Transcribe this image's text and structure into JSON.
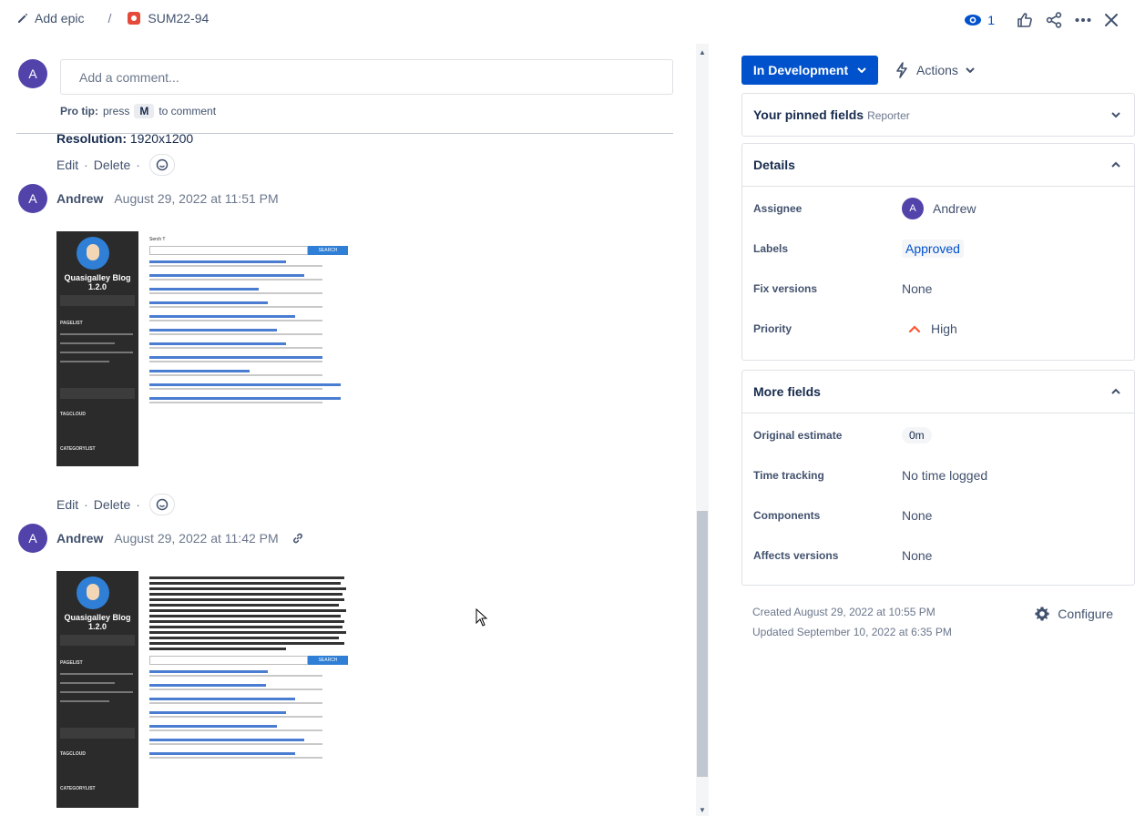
{
  "topbar": {
    "add_epic": "Add epic",
    "issue_key": "SUM22-94",
    "watch_count": "1"
  },
  "comment_box": {
    "avatar": "A",
    "placeholder": "Add a comment...",
    "protip_label": "Pro tip:",
    "protip_press": "press",
    "protip_key": "M",
    "protip_suffix": "to comment"
  },
  "comments": [
    {
      "resolution_label": "Resolution:",
      "resolution_value": "1920x1200",
      "edit": "Edit",
      "delete": "Delete"
    },
    {
      "avatar": "A",
      "author": "Andrew",
      "date": "August 29, 2022 at 11:51 PM",
      "edit": "Edit",
      "delete": "Delete",
      "screenshot": {
        "blog_title": "Quasigalley Blog 1.2.0",
        "search_label": "Serch 'l'",
        "search_button": "SEARCH",
        "side_labels": [
          "PAGELIST",
          "TAGCLOUD",
          "CATEGORYLIST"
        ]
      }
    },
    {
      "avatar": "A",
      "author": "Andrew",
      "date": "August 29, 2022 at 11:42 PM",
      "screenshot": {
        "blog_title": "Quasigalley Blog 1.2.0",
        "search_button": "SEARCH",
        "side_labels": [
          "PAGELIST",
          "TAGCLOUD",
          "CATEGORYLIST"
        ]
      }
    }
  ],
  "sidebar": {
    "status": "In Development",
    "actions": "Actions",
    "pinned": {
      "title": "Your pinned fields",
      "sub": "Reporter"
    },
    "details": {
      "title": "Details",
      "fields": [
        {
          "label": "Assignee",
          "value": "Andrew",
          "avatar": "A"
        },
        {
          "label": "Labels",
          "value": "Approved"
        },
        {
          "label": "Fix versions",
          "value": "None"
        },
        {
          "label": "Priority",
          "value": "High"
        }
      ]
    },
    "more": {
      "title": "More fields",
      "fields": [
        {
          "label": "Original estimate",
          "value": "0m"
        },
        {
          "label": "Time tracking",
          "value": "No time logged"
        },
        {
          "label": "Components",
          "value": "None"
        },
        {
          "label": "Affects versions",
          "value": "None"
        }
      ]
    },
    "created": "Created August 29, 2022 at 10:55 PM",
    "updated": "Updated September 10, 2022 at 6:35 PM",
    "configure": "Configure"
  },
  "colors": {
    "primary": "#0052cc",
    "avatar": "#5243aa",
    "priority_high": "#ff5630",
    "issue_type": "#e5493a"
  }
}
